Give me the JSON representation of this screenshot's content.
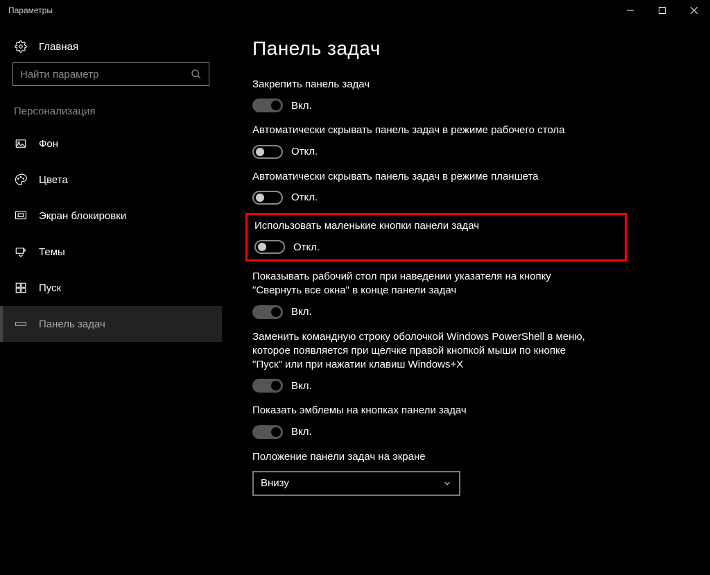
{
  "window": {
    "title": "Параметры"
  },
  "sidebar": {
    "home": "Главная",
    "search_placeholder": "Найти параметр",
    "category": "Персонализация",
    "items": [
      {
        "label": "Фон"
      },
      {
        "label": "Цвета"
      },
      {
        "label": "Экран блокировки"
      },
      {
        "label": "Темы"
      },
      {
        "label": "Пуск"
      },
      {
        "label": "Панель задач"
      }
    ]
  },
  "content": {
    "heading": "Панель задач",
    "settings": [
      {
        "label": "Закрепить панель задач",
        "on": true,
        "state": "Вкл."
      },
      {
        "label": "Автоматически скрывать панель задач в режиме рабочего стола",
        "on": false,
        "state": "Откл."
      },
      {
        "label": "Автоматически скрывать панель задач в режиме планшета",
        "on": false,
        "state": "Откл."
      },
      {
        "label": "Использовать маленькие кнопки панели задач",
        "on": false,
        "state": "Откл.",
        "highlighted": true
      },
      {
        "label": "Показывать рабочий стол при наведении указателя на кнопку \"Свернуть все окна\" в конце панели задач",
        "on": true,
        "state": "Вкл."
      },
      {
        "label": "Заменить командную строку оболочкой Windows PowerShell в меню, которое появляется при щелчке правой кнопкой мыши по кнопке \"Пуск\" или при нажатии клавиш Windows+X",
        "on": true,
        "state": "Вкл."
      },
      {
        "label": "Показать эмблемы на кнопках панели задач",
        "on": true,
        "state": "Вкл."
      }
    ],
    "position": {
      "label": "Положение панели задач на экране",
      "value": "Внизу"
    }
  }
}
